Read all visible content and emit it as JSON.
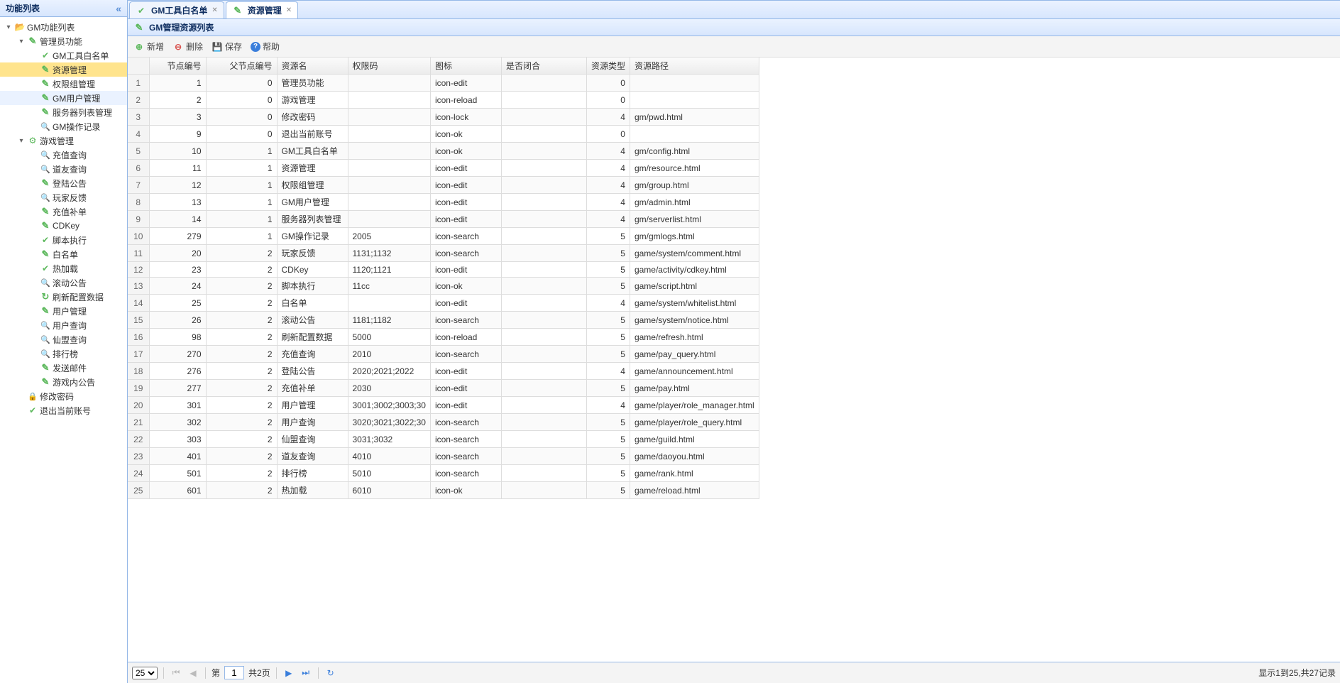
{
  "sidebar": {
    "title": "功能列表",
    "tree": [
      {
        "lvl": 0,
        "expand": "-",
        "icon": "folder-open",
        "label": "GM功能列表",
        "sel": false
      },
      {
        "lvl": 1,
        "expand": "-",
        "icon": "edit",
        "label": "管理员功能",
        "sel": false
      },
      {
        "lvl": 2,
        "expand": "",
        "icon": "ok",
        "label": "GM工具白名单",
        "sel": false
      },
      {
        "lvl": 2,
        "expand": "",
        "icon": "edit",
        "label": "资源管理",
        "sel": true
      },
      {
        "lvl": 2,
        "expand": "",
        "icon": "edit",
        "label": "权限组管理",
        "sel": false
      },
      {
        "lvl": 2,
        "expand": "",
        "icon": "edit",
        "label": "GM用户管理",
        "hov": true
      },
      {
        "lvl": 2,
        "expand": "",
        "icon": "edit",
        "label": "服务器列表管理",
        "sel": false
      },
      {
        "lvl": 2,
        "expand": "",
        "icon": "search",
        "label": "GM操作记录",
        "sel": false
      },
      {
        "lvl": 1,
        "expand": "-",
        "icon": "cog",
        "label": "游戏管理",
        "sel": false
      },
      {
        "lvl": 2,
        "expand": "",
        "icon": "search",
        "label": "充值查询",
        "sel": false
      },
      {
        "lvl": 2,
        "expand": "",
        "icon": "search",
        "label": "道友查询",
        "sel": false
      },
      {
        "lvl": 2,
        "expand": "",
        "icon": "edit",
        "label": "登陆公告",
        "sel": false
      },
      {
        "lvl": 2,
        "expand": "",
        "icon": "search",
        "label": "玩家反馈",
        "sel": false
      },
      {
        "lvl": 2,
        "expand": "",
        "icon": "edit",
        "label": "充值补单",
        "sel": false
      },
      {
        "lvl": 2,
        "expand": "",
        "icon": "edit",
        "label": "CDKey",
        "sel": false
      },
      {
        "lvl": 2,
        "expand": "",
        "icon": "ok",
        "label": "脚本执行",
        "sel": false
      },
      {
        "lvl": 2,
        "expand": "",
        "icon": "edit",
        "label": "白名单",
        "sel": false
      },
      {
        "lvl": 2,
        "expand": "",
        "icon": "ok",
        "label": "热加载",
        "sel": false
      },
      {
        "lvl": 2,
        "expand": "",
        "icon": "search",
        "label": "滚动公告",
        "sel": false
      },
      {
        "lvl": 2,
        "expand": "",
        "icon": "reload",
        "label": "刷新配置数据",
        "sel": false
      },
      {
        "lvl": 2,
        "expand": "",
        "icon": "edit",
        "label": "用户管理",
        "sel": false
      },
      {
        "lvl": 2,
        "expand": "",
        "icon": "search",
        "label": "用户查询",
        "sel": false
      },
      {
        "lvl": 2,
        "expand": "",
        "icon": "search",
        "label": "仙盟查询",
        "sel": false
      },
      {
        "lvl": 2,
        "expand": "",
        "icon": "search",
        "label": "排行榜",
        "sel": false
      },
      {
        "lvl": 2,
        "expand": "",
        "icon": "edit",
        "label": "发送邮件",
        "sel": false
      },
      {
        "lvl": 2,
        "expand": "",
        "icon": "edit",
        "label": "游戏内公告",
        "sel": false
      },
      {
        "lvl": 1,
        "expand": "",
        "icon": "lock",
        "label": "修改密码",
        "sel": false
      },
      {
        "lvl": 1,
        "expand": "",
        "icon": "ok",
        "label": "退出当前账号",
        "sel": false
      }
    ]
  },
  "tabs": [
    {
      "icon": "ok",
      "label": "GM工具白名单",
      "active": false
    },
    {
      "icon": "edit",
      "label": "资源管理",
      "active": true
    }
  ],
  "panel_title": "GM管理资源列表",
  "toolbar": {
    "add": "新增",
    "del": "删除",
    "save": "保存",
    "help": "帮助"
  },
  "grid": {
    "headers": [
      "",
      "节点编号",
      "父节点编号",
      "资源名",
      "权限码",
      "图标",
      "是否闭合",
      "资源类型",
      "资源路径"
    ],
    "rows": [
      [
        "1",
        "1",
        "0",
        "管理员功能",
        "",
        "icon-edit",
        "",
        "0",
        ""
      ],
      [
        "2",
        "2",
        "0",
        "游戏管理",
        "",
        "icon-reload",
        "",
        "0",
        ""
      ],
      [
        "3",
        "3",
        "0",
        "修改密码",
        "",
        "icon-lock",
        "",
        "4",
        "gm/pwd.html"
      ],
      [
        "4",
        "9",
        "0",
        "退出当前账号",
        "",
        "icon-ok",
        "",
        "0",
        ""
      ],
      [
        "5",
        "10",
        "1",
        "GM工具白名单",
        "",
        "icon-ok",
        "",
        "4",
        "gm/config.html"
      ],
      [
        "6",
        "11",
        "1",
        "资源管理",
        "",
        "icon-edit",
        "",
        "4",
        "gm/resource.html"
      ],
      [
        "7",
        "12",
        "1",
        "权限组管理",
        "",
        "icon-edit",
        "",
        "4",
        "gm/group.html"
      ],
      [
        "8",
        "13",
        "1",
        "GM用户管理",
        "",
        "icon-edit",
        "",
        "4",
        "gm/admin.html"
      ],
      [
        "9",
        "14",
        "1",
        "服务器列表管理",
        "",
        "icon-edit",
        "",
        "4",
        "gm/serverlist.html"
      ],
      [
        "10",
        "279",
        "1",
        "GM操作记录",
        "2005",
        "icon-search",
        "",
        "5",
        "gm/gmlogs.html"
      ],
      [
        "11",
        "20",
        "2",
        "玩家反馈",
        "1131;1132",
        "icon-search",
        "",
        "5",
        "game/system/comment.html"
      ],
      [
        "12",
        "23",
        "2",
        "CDKey",
        "1120;1121",
        "icon-edit",
        "",
        "5",
        "game/activity/cdkey.html"
      ],
      [
        "13",
        "24",
        "2",
        "脚本执行",
        "11cc",
        "icon-ok",
        "",
        "5",
        "game/script.html"
      ],
      [
        "14",
        "25",
        "2",
        "白名单",
        "",
        "icon-edit",
        "",
        "4",
        "game/system/whitelist.html"
      ],
      [
        "15",
        "26",
        "2",
        "滚动公告",
        "1181;1182",
        "icon-search",
        "",
        "5",
        "game/system/notice.html"
      ],
      [
        "16",
        "98",
        "2",
        "刷新配置数据",
        "5000",
        "icon-reload",
        "",
        "5",
        "game/refresh.html"
      ],
      [
        "17",
        "270",
        "2",
        "充值查询",
        "2010",
        "icon-search",
        "",
        "5",
        "game/pay_query.html"
      ],
      [
        "18",
        "276",
        "2",
        "登陆公告",
        "2020;2021;2022",
        "icon-edit",
        "",
        "4",
        "game/announcement.html"
      ],
      [
        "19",
        "277",
        "2",
        "充值补单",
        "2030",
        "icon-edit",
        "",
        "5",
        "game/pay.html"
      ],
      [
        "20",
        "301",
        "2",
        "用户管理",
        "3001;3002;3003;30",
        "icon-edit",
        "",
        "4",
        "game/player/role_manager.html"
      ],
      [
        "21",
        "302",
        "2",
        "用户查询",
        "3020;3021;3022;30",
        "icon-search",
        "",
        "5",
        "game/player/role_query.html"
      ],
      [
        "22",
        "303",
        "2",
        "仙盟查询",
        "3031;3032",
        "icon-search",
        "",
        "5",
        "game/guild.html"
      ],
      [
        "23",
        "401",
        "2",
        "道友查询",
        "4010",
        "icon-search",
        "",
        "5",
        "game/daoyou.html"
      ],
      [
        "24",
        "501",
        "2",
        "排行榜",
        "5010",
        "icon-search",
        "",
        "5",
        "game/rank.html"
      ],
      [
        "25",
        "601",
        "2",
        "热加载",
        "6010",
        "icon-ok",
        "",
        "5",
        "game/reload.html"
      ]
    ]
  },
  "pager": {
    "page_size": "25",
    "page_label_prefix": "第",
    "page": "1",
    "page_label_suffix": "共2页",
    "info": "显示1到25,共27记录"
  }
}
